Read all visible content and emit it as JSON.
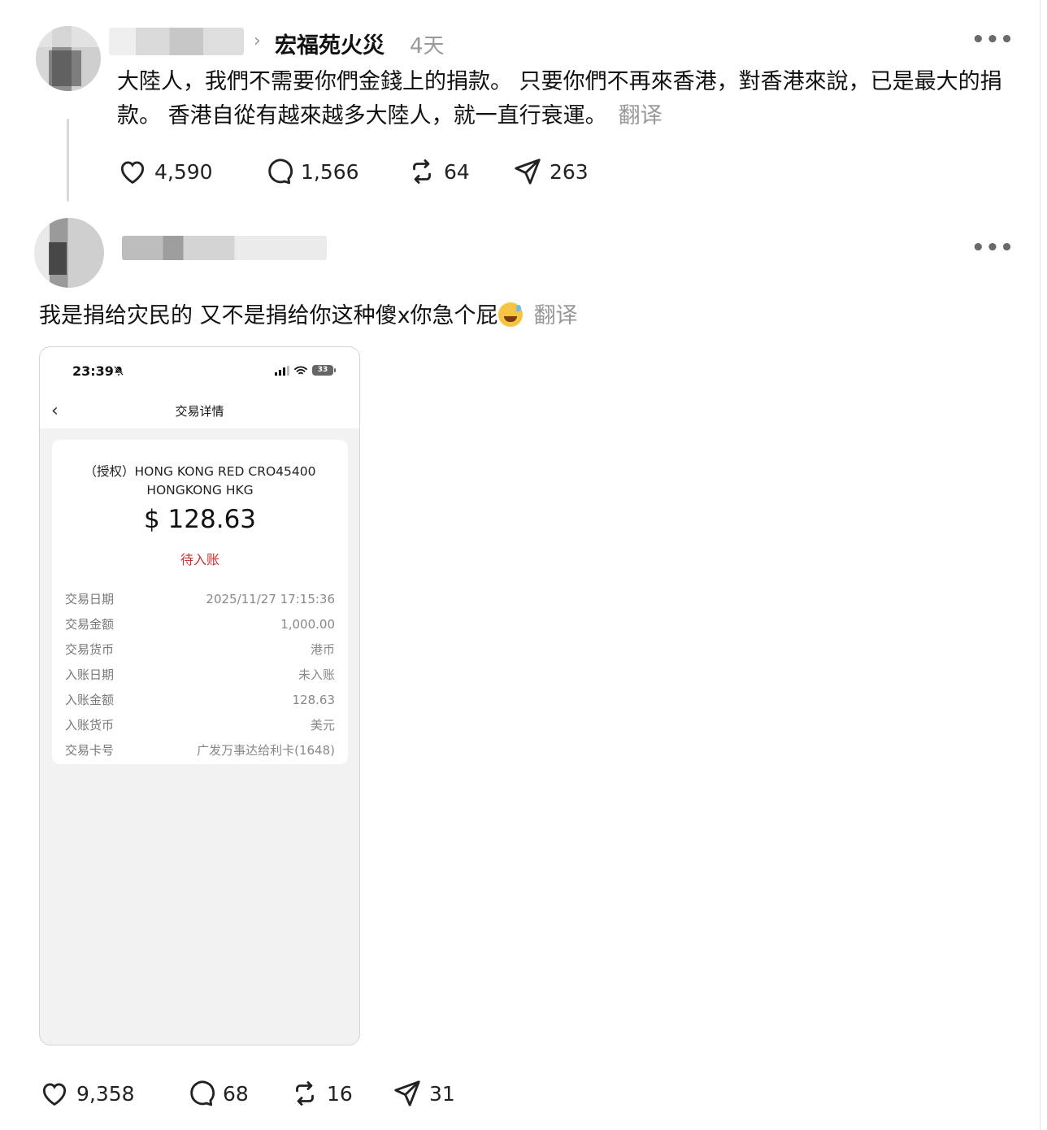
{
  "post1": {
    "topic": "宏福苑火災",
    "time": "4天",
    "body": "大陸人，我們不需要你們金錢上的捐款。 只要你們不再來香港，對香港來說，已是最大的捐款。 香港自從有越來越多大陸人，就一直行衰運。",
    "translate": "翻译",
    "actions": {
      "likes": "4,590",
      "replies": "1,566",
      "reposts": "64",
      "shares": "263"
    }
  },
  "post2": {
    "body": "我是捐给灾民的 又不是捐给你这种傻x你急个屁",
    "translate": "翻译",
    "actions": {
      "likes": "9,358",
      "replies": "68",
      "reposts": "16",
      "shares": "31"
    }
  },
  "receipt": {
    "status_time": "23:39",
    "battery": "33",
    "nav_title": "交易详情",
    "merchant_line1": "（授权）HONG KONG RED CRO45400",
    "merchant_line2": "HONGKONG HKG",
    "amount": "$ 128.63",
    "status": "待入账",
    "rows": [
      {
        "label": "交易日期",
        "value": "2025/11/27 17:15:36"
      },
      {
        "label": "交易金额",
        "value": "1,000.00"
      },
      {
        "label": "交易货币",
        "value": "港币"
      },
      {
        "label": "入账日期",
        "value": "未入账"
      },
      {
        "label": "入账金额",
        "value": "128.63"
      },
      {
        "label": "入账货币",
        "value": "美元"
      },
      {
        "label": "交易卡号",
        "value": "广发万事达给利卡(1648)"
      }
    ]
  },
  "icons": [
    "heart-icon",
    "comment-icon",
    "repost-icon",
    "share-icon",
    "more-icon",
    "bell-mute-icon",
    "signal-icon",
    "wifi-icon",
    "battery-icon",
    "back-icon"
  ]
}
